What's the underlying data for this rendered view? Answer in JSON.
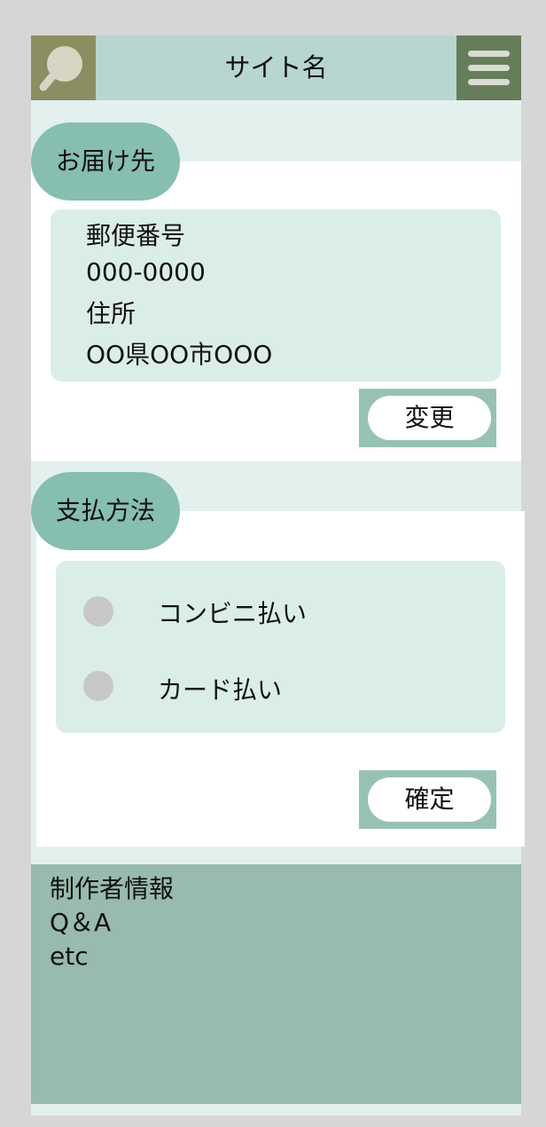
{
  "header": {
    "title": "サイト名",
    "search_icon": "magnifier-icon",
    "menu_icon": "hamburger-menu-icon"
  },
  "delivery": {
    "heading": "お届け先",
    "postal_label": "郵便番号",
    "postal_value": "000-0000",
    "address_label": "住所",
    "address_value": "OO県OO市OOO",
    "change_button": "変更"
  },
  "payment": {
    "heading": "支払方法",
    "options": [
      {
        "label": "コンビニ払い"
      },
      {
        "label": "カード払い"
      }
    ],
    "confirm_button": "確定"
  },
  "footer": {
    "lines": [
      "制作者情報",
      "Q＆A",
      "etc"
    ]
  },
  "colors": {
    "background": "#d6d6d6",
    "header": "#b7d6cf",
    "search_button": "#8c8e62",
    "menu_button": "#667d5a",
    "pill": "#86beb0",
    "panel": "#daeee6",
    "button_frame": "#97c2b3",
    "footer": "#98bab0",
    "radio": "#c8c8c8"
  }
}
